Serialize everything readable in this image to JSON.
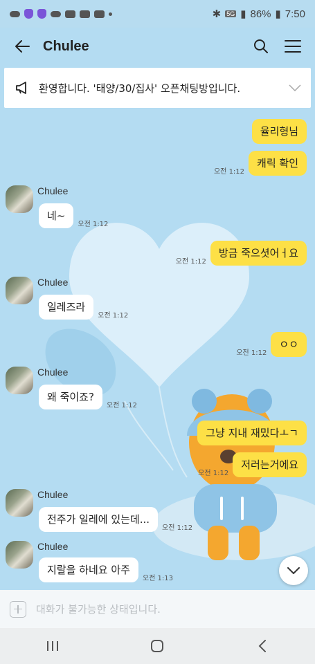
{
  "status_bar": {
    "network": "5G",
    "battery": "86%",
    "time": "7:50"
  },
  "header": {
    "title": "Chulee"
  },
  "notice": {
    "text": "환영합니다. '태양/30/집사' 오픈채팅방입니다."
  },
  "messages": [
    {
      "sender": "me",
      "text": "율리형님",
      "time": ""
    },
    {
      "sender": "me",
      "text": "캐릭 확인",
      "time": "오전 1:12"
    },
    {
      "sender": "Chulee",
      "text": "네~",
      "time": "오전 1:12"
    },
    {
      "sender": "me",
      "text": "방금 죽으셧어ㅓ요",
      "time": "오전 1:12"
    },
    {
      "sender": "Chulee",
      "text": "일레즈라",
      "time": "오전 1:12"
    },
    {
      "sender": "me",
      "text": "ㅇㅇ",
      "time": "오전 1:12"
    },
    {
      "sender": "Chulee",
      "text": "왜 죽이죠?",
      "time": "오전 1:12"
    },
    {
      "sender": "me",
      "text": "그냥 지내 재밌다ㅗㄱ",
      "time": ""
    },
    {
      "sender": "me",
      "text": "저러는거에요",
      "time": "오전 1:12"
    },
    {
      "sender": "Chulee",
      "text": "전주가 일레에 있는데...",
      "time": "오전 1:12"
    },
    {
      "sender": "Chulee",
      "text": "지랄을 하네요 아주",
      "time": "오전 1:13"
    }
  ],
  "input": {
    "placeholder": "대화가 불가능한 상태입니다."
  },
  "colors": {
    "background": "#b4dcf2",
    "my_bubble": "#fde046",
    "other_bubble": "#ffffff"
  }
}
